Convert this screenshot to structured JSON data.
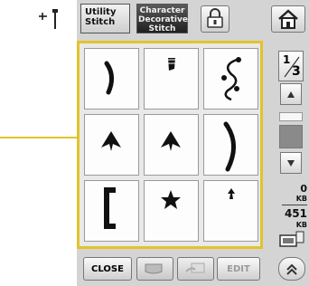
{
  "tabs": {
    "utility_line1": "Utility",
    "utility_line2": "Stitch",
    "character_line1": "Character",
    "character_line2": "Decorative",
    "character_line3": "Stitch"
  },
  "pager": {
    "current": "1",
    "total": "3"
  },
  "memory": {
    "value1": "0",
    "unit1": "KB",
    "value2": "451",
    "unit2": "KB"
  },
  "bottom": {
    "close_label": "CLOSE",
    "edit_label": "EDIT"
  },
  "stitch_patterns": [
    "stitch-pattern-1",
    "stitch-pattern-2",
    "stitch-pattern-3",
    "stitch-pattern-4",
    "stitch-pattern-5",
    "stitch-pattern-6",
    "stitch-pattern-7",
    "stitch-pattern-8",
    "stitch-pattern-9"
  ],
  "colors": {
    "grid_border": "#e2c32c",
    "callout_line": "#e2c32c"
  }
}
